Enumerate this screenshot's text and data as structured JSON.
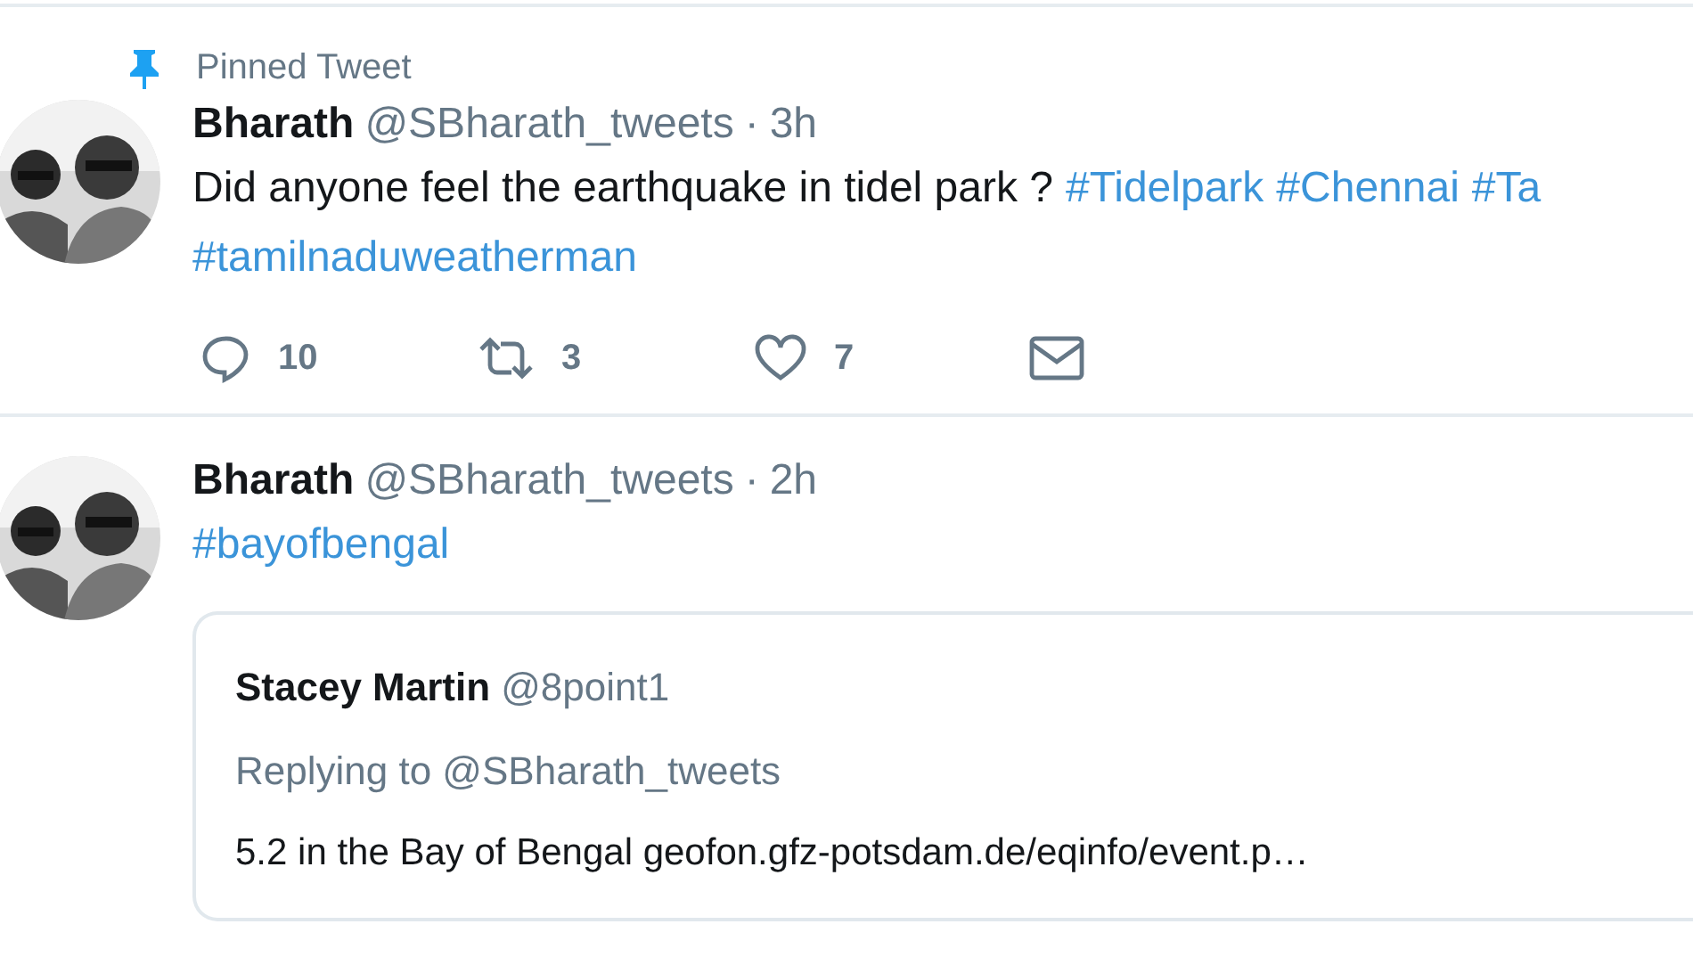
{
  "tweets": [
    {
      "pinned_label": "Pinned Tweet",
      "name": "Bharath",
      "handle": "@SBharath_tweets",
      "separator": "·",
      "time": "3h",
      "text": [
        {
          "kind": "text",
          "text": "Did anyone feel the earthquake in tidel park ?"
        },
        {
          "kind": "hashtag",
          "text": "#Tidelpark"
        },
        {
          "kind": "hashtag",
          "text": "#Chennai"
        },
        {
          "kind": "hashtag",
          "text": "#Ta"
        },
        {
          "kind": "break"
        },
        {
          "kind": "hashtag",
          "text": "#tamilnaduweatherman"
        }
      ],
      "actions": [
        {
          "kind": "reply",
          "count": "10"
        },
        {
          "kind": "retweet",
          "count": "3"
        },
        {
          "kind": "like",
          "count": "7"
        },
        {
          "kind": "message"
        }
      ]
    },
    {
      "name": "Bharath",
      "handle": "@SBharath_tweets",
      "separator": "·",
      "time": "2h",
      "text": [
        {
          "kind": "hashtag",
          "text": "#bayofbengal"
        }
      ],
      "quote": {
        "name": "Stacey Martin",
        "handle": "@8point1",
        "replying_to": "Replying to @SBharath_tweets",
        "text": "5.2 in the Bay of Bengal geofon.gfz-potsdam.de/eqinfo/event.p…"
      }
    }
  ]
}
